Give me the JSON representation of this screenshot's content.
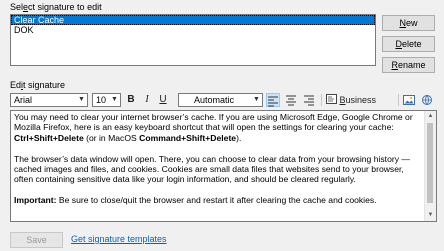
{
  "select_label_prefix": "Sel",
  "select_label_accel": "e",
  "select_label_suffix": "ct signature to edit",
  "signatures": [
    "Clear Cache",
    "DOK"
  ],
  "buttons": {
    "new_accel": "N",
    "new_rest": "ew",
    "delete_accel": "D",
    "delete_rest": "elete",
    "rename_accel": "R",
    "rename_rest": "ename",
    "save": "Save"
  },
  "edit_label_prefix": "Ed",
  "edit_label_accel": "i",
  "edit_label_suffix": "t signature",
  "toolbar": {
    "font": "Arial",
    "size": "10",
    "bold": "B",
    "italic": "I",
    "underline": "U",
    "color": "Automatic",
    "business_card_accel": "B",
    "business_card_rest": "usiness Card"
  },
  "body": {
    "p1_a": "You may need to clear your internet browser’s cache.  If you are using Microsoft Edge, Google Chrome or Mozilla Firefox, here is an easy keyboard shortcut that will open the settings for clearing your cache: ",
    "p1_b": "Ctrl+Shift+Delete",
    "p1_c": " (or in MacOS ",
    "p1_d": "Command+Shift+Delete",
    "p1_e": ").",
    "p2": "The browser’s data window will open. There, you can choose to clear data from your browsing history — cached images and files, and cookies. Cookies are small data files that websites send to your browser, often containing sensitive data like your login information, and should be cleared regularly.",
    "p3_a": "Important:",
    "p3_b": " Be sure to close/quit the browser and restart it after clearing the cache and cookies."
  },
  "templates_link": "Get signature templates",
  "colors": {
    "selection": "#0078d7",
    "link": "#0563c1"
  }
}
